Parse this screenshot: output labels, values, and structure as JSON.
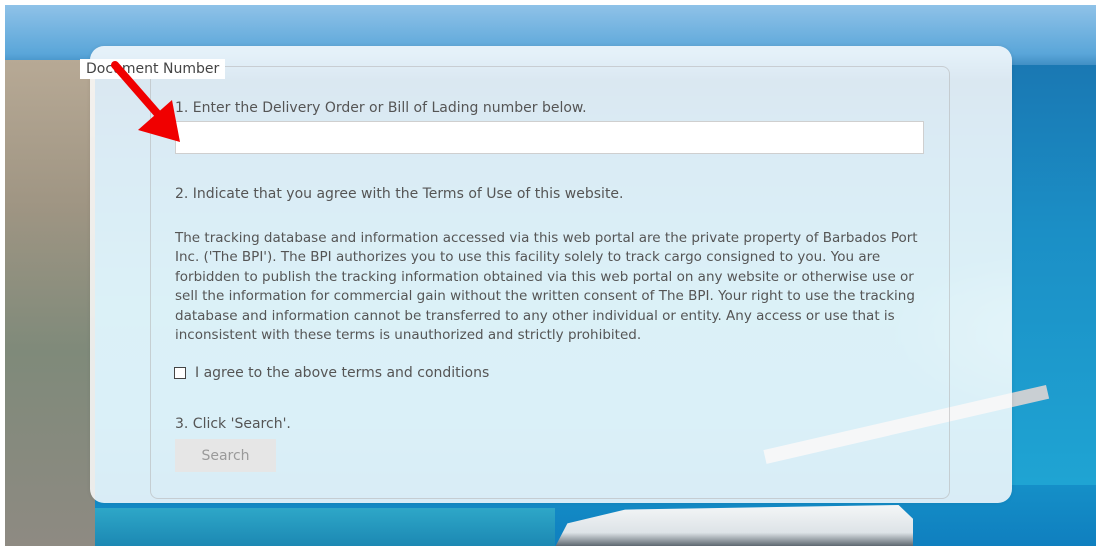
{
  "form": {
    "legend": "Document Number",
    "step1_label": "1. Enter the Delivery Order or Bill of Lading number below.",
    "document_number_value": "",
    "step2_label": "2. Indicate that you agree with the Terms of Use of this website.",
    "terms_text": "The tracking database and information accessed via this web portal are the private property of Barbados Port Inc. ('The BPI'). The BPI authorizes you to use this facility solely to track cargo consigned to you. You are forbidden to publish the tracking information obtained via this web portal on any website or otherwise use or sell the information for commercial gain without the written consent of The BPI. Your right to use the tracking database and information cannot be transferred to any other individual or entity. Any access or use that is inconsistent with these terms is unauthorized and strictly prohibited.",
    "agree_label": "I agree to the above terms and conditions",
    "agree_checked": false,
    "step3_label": "3. Click 'Search'.",
    "search_label": "Search",
    "search_enabled": false
  },
  "annotation": {
    "arrow_color": "#f00000",
    "points_to": "document-number-input"
  },
  "icons": {
    "annotation_arrow": "red-arrow-icon",
    "agree_checkbox": "checkbox-icon"
  }
}
